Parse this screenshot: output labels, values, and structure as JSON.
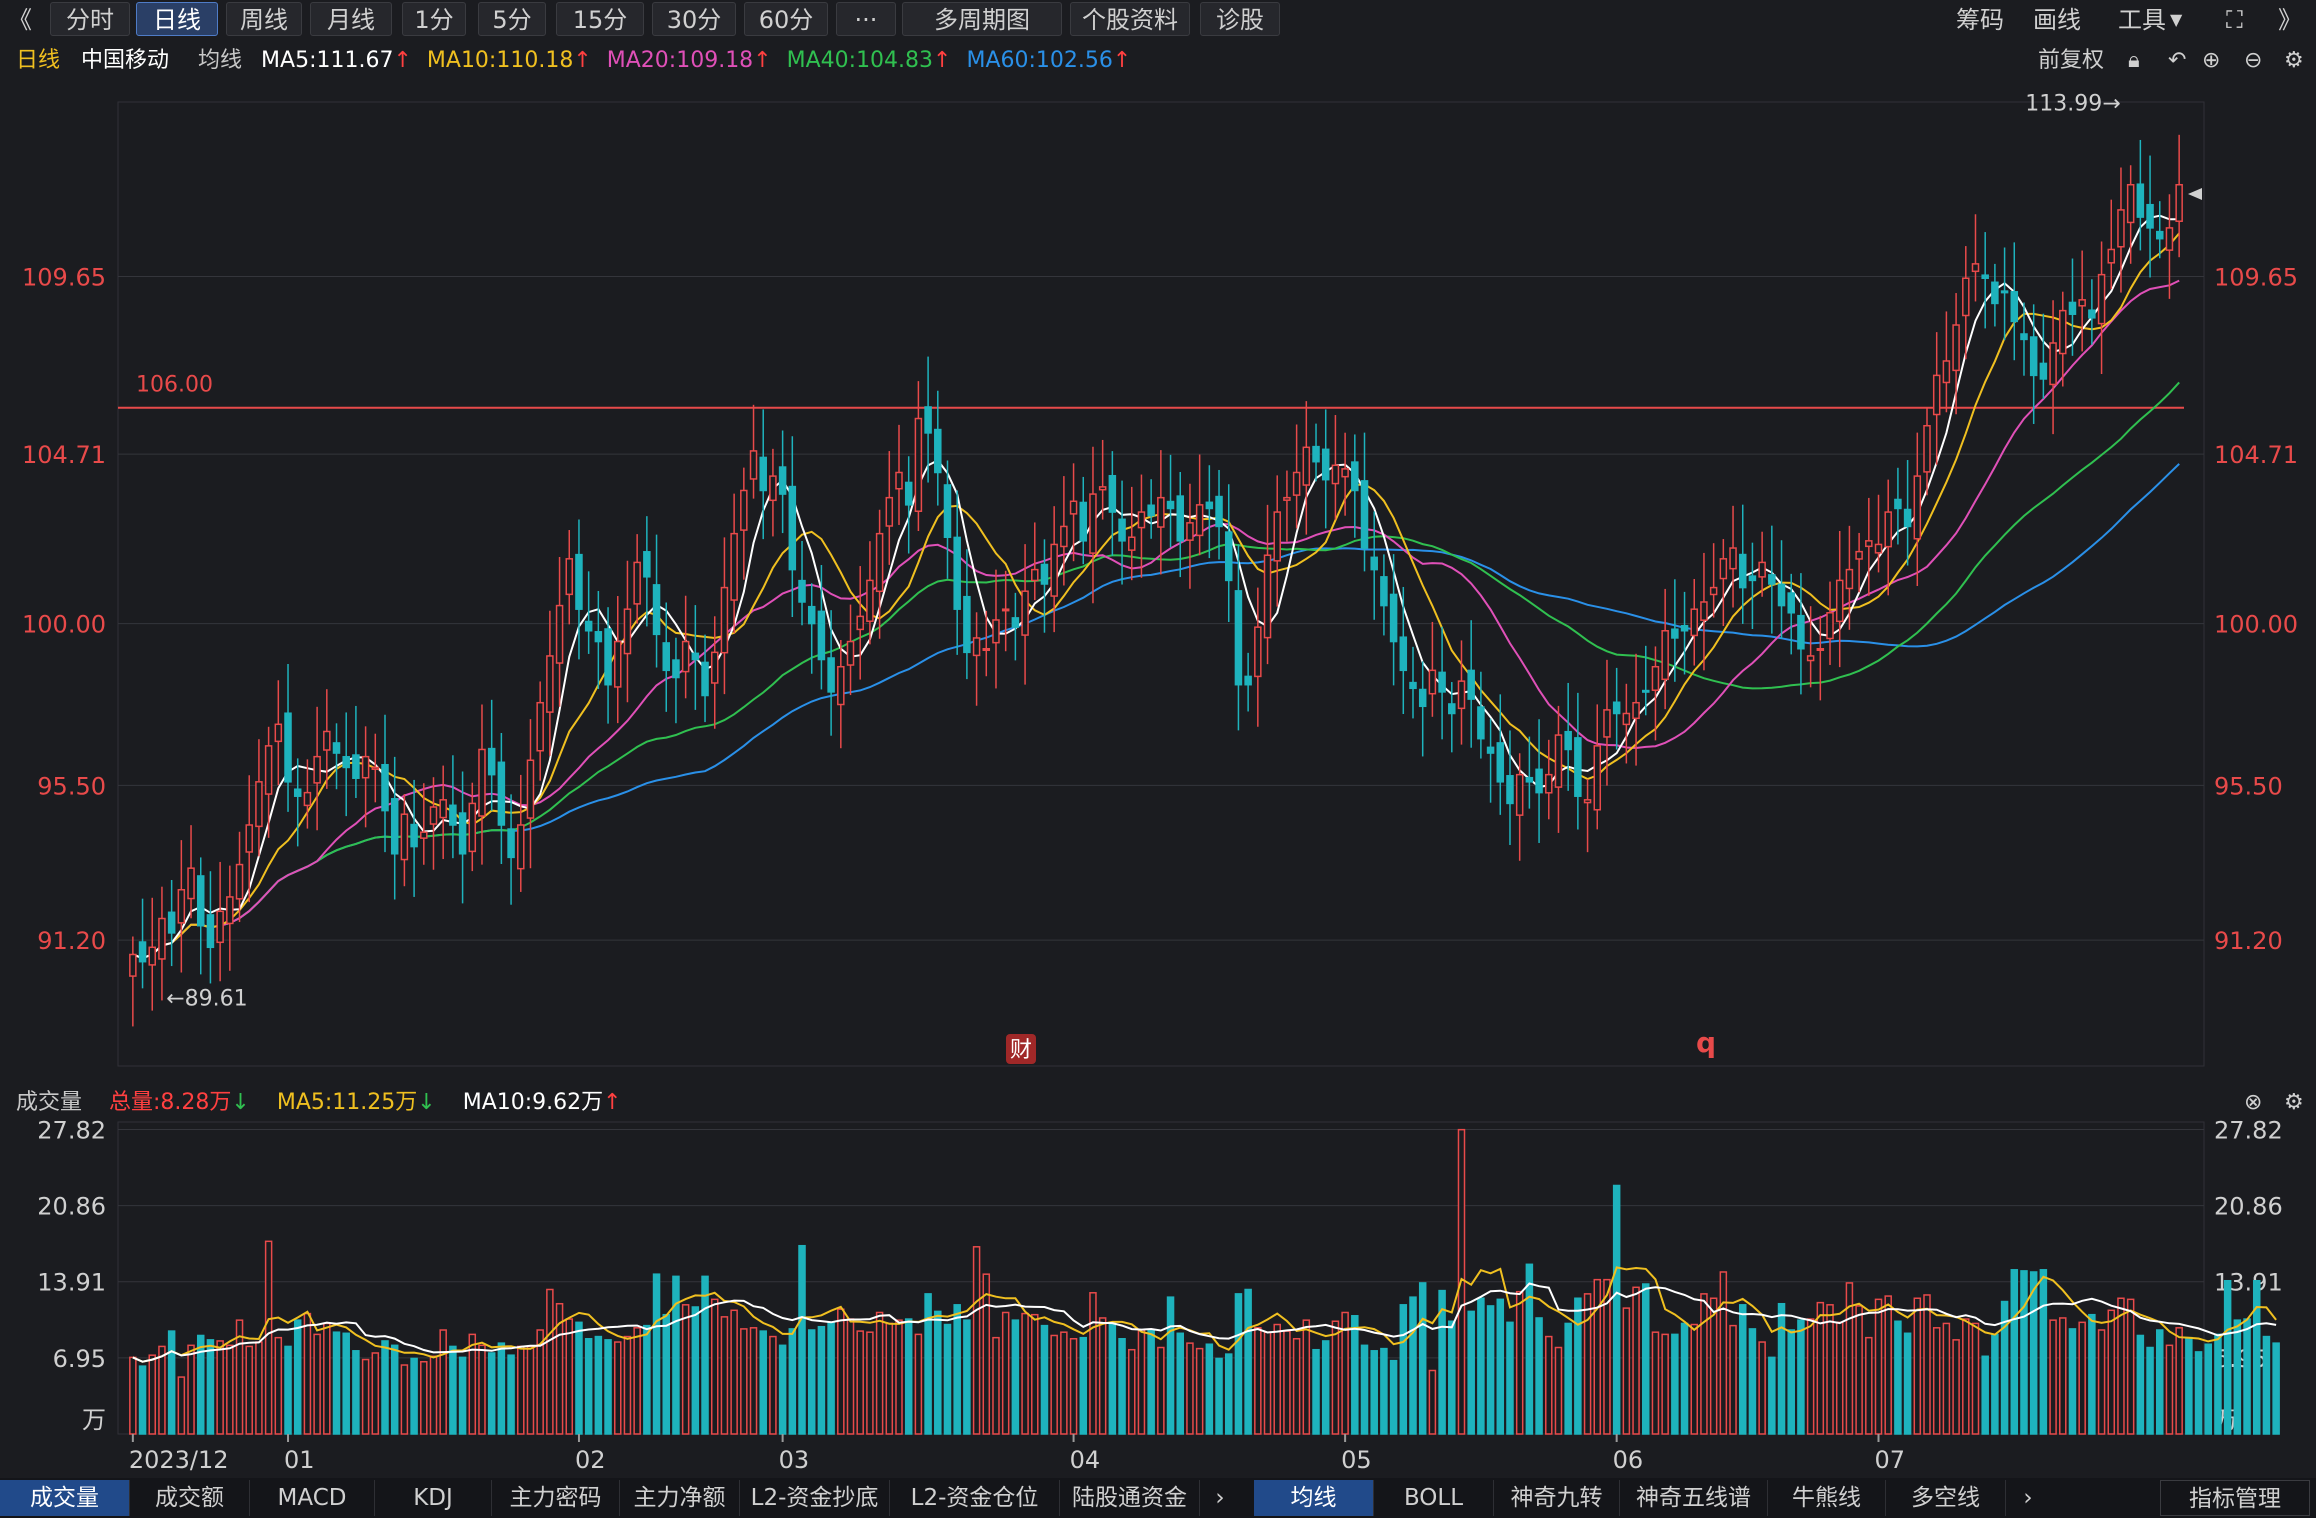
{
  "toolbar": {
    "back": "《",
    "buttons": [
      "分时",
      "日线",
      "周线",
      "月线",
      "1分",
      "5分",
      "15分",
      "30分",
      "60分",
      "···",
      "多周期图",
      "个股资料",
      "诊股"
    ],
    "active": "日线",
    "right": [
      "筹码",
      "画线",
      "工具"
    ]
  },
  "price_legend": {
    "period": "日线",
    "stock": "中国移动",
    "ma_label": "均线",
    "ma5": "MA5:111.67",
    "ma10": "MA10:110.18",
    "ma20": "MA20:109.18",
    "ma40": "MA40:104.83",
    "ma60": "MA60:102.56",
    "adjust": "前复权"
  },
  "volume_legend": {
    "title": "成交量",
    "total": "总量:8.28万",
    "ma5": "MA5:11.25万",
    "ma10": "MA10:9.62万"
  },
  "colors": {
    "up": "#e84a4a",
    "down": "#1eb3bd",
    "ma5": "#ffffff",
    "ma10": "#f0c020",
    "ma20": "#e050b8",
    "ma40": "#30c050",
    "ma60": "#2a90e8",
    "accent": "#2a3f66"
  },
  "chart_data": {
    "type": "candlestick",
    "y_ticks": [
      "109.65",
      "104.71",
      "100.00",
      "95.50",
      "91.20"
    ],
    "ylim": [
      87.7,
      114.5
    ],
    "hline": {
      "value": 106.0,
      "label": "106.00"
    },
    "high_label": "113.99→",
    "low_label": "←89.61",
    "markers": [
      "财",
      "q"
    ],
    "x_labels": [
      "2023/12",
      "01",
      "02",
      "03",
      "04",
      "05",
      "06",
      "07"
    ],
    "volume_ticks": [
      "27.82",
      "20.86",
      "13.91",
      "6.95"
    ],
    "volume_unit": "万",
    "volume_ylim": [
      0,
      28.5
    ],
    "closes": [
      90.8,
      90.6,
      91.0,
      91.8,
      91.4,
      92.6,
      93.2,
      91.6,
      91.0,
      92.0,
      92.4,
      93.3,
      94.4,
      95.6,
      96.6,
      97.2,
      95.6,
      95.2,
      95.3,
      96.3,
      97.0,
      96.4,
      96.0,
      95.7,
      96.3,
      96.0,
      94.8,
      93.6,
      94.7,
      93.8,
      94.2,
      94.9,
      95.1,
      94.4,
      93.6,
      95.0,
      96.5,
      95.8,
      94.4,
      93.5,
      94.4,
      96.2,
      97.8,
      99.1,
      100.5,
      101.8,
      100.4,
      99.8,
      99.5,
      98.3,
      99.5,
      100.4,
      101.7,
      101.3,
      99.7,
      98.7,
      98.5,
      99.5,
      99.0,
      98.0,
      99.2,
      101.0,
      102.5,
      103.7,
      104.8,
      103.7,
      104.1,
      103.6,
      101.5,
      100.6,
      100.0,
      99.0,
      98.1,
      98.8,
      99.5,
      100.2,
      101.2,
      102.5,
      103.5,
      104.2,
      103.3,
      105.7,
      105.3,
      104.2,
      102.4,
      100.4,
      99.2,
      99.6,
      99.3,
      100.1,
      100.4,
      99.9,
      100.9,
      101.5,
      101.1,
      102.2,
      102.7,
      103.4,
      102.3,
      103.6,
      103.8,
      103.1,
      102.3,
      102.4,
      103.1,
      103.0,
      103.5,
      103.2,
      102.3,
      102.8,
      103.3,
      103.2,
      102.7,
      101.2,
      98.3,
      98.3,
      99.9,
      101.9,
      103.1,
      103.5,
      104.2,
      104.9,
      104.5,
      104.0,
      104.4,
      104.3,
      103.7,
      102.1,
      101.5,
      100.5,
      99.5,
      98.7,
      98.2,
      97.7,
      98.7,
      98.1,
      97.5,
      98.4,
      97.9,
      96.8,
      96.4,
      95.6,
      95.0,
      95.8,
      95.6,
      95.3,
      95.8,
      96.9,
      96.5,
      95.2,
      95.1,
      96.6,
      97.6,
      97.5,
      97.5,
      97.8,
      98.1,
      98.8,
      99.8,
      99.6,
      99.8,
      100.4,
      100.6,
      101.0,
      101.8,
      102.1,
      101.0,
      101.2,
      101.7,
      101.1,
      100.5,
      100.3,
      99.3,
      99.1,
      99.3,
      100.3,
      101.2,
      101.5,
      102.0,
      102.3,
      102.2,
      103.1,
      103.2,
      102.7,
      104.1,
      105.5,
      106.9,
      107.3,
      108.3,
      109.6,
      110.0,
      109.6,
      108.9,
      109.2,
      108.4,
      107.9,
      106.9,
      106.8,
      107.8,
      108.7,
      108.6,
      109.0,
      108.5,
      109.7,
      110.4,
      111.5,
      112.2,
      111.3,
      111.0,
      110.7,
      111.0,
      112.2
    ],
    "volumes": [
      7.0,
      6.2,
      7.2,
      8.0,
      9.4,
      5.2,
      8.1,
      9.0,
      8.6,
      8.5,
      8.1,
      10.4,
      8.0,
      8.4,
      17.6,
      8.8,
      8.0,
      10.4,
      11.0,
      9.1,
      10.1,
      9.3,
      9.2,
      7.6,
      6.8,
      7.4,
      8.5,
      8.1,
      6.3,
      6.9,
      6.6,
      7.1,
      9.5,
      8.0,
      7.0,
      9.1,
      8.1,
      7.4,
      8.3,
      7.2,
      8.0,
      8.0,
      9.5,
      13.2,
      11.9,
      10.5,
      10.2,
      8.7,
      8.9,
      8.6,
      8.4,
      8.9,
      9.7,
      9.9,
      14.6,
      10.9,
      14.4,
      11.8,
      11.6,
      14.4,
      12.3,
      10.7,
      11.3,
      9.6,
      9.7,
      9.4,
      8.9,
      8.1,
      9.6,
      17.2,
      9.5,
      9.8,
      10.2,
      11.4,
      10.5,
      9.4,
      9.3,
      11.1,
      10.1,
      10.4,
      10.5,
      9.1,
      12.8,
      11.2,
      10.0,
      11.8,
      10.4,
      17.1,
      14.6,
      8.8,
      11.1,
      10.4,
      11.0,
      10.9,
      9.9,
      9.0,
      9.3,
      8.7,
      8.8,
      12.9,
      10.6,
      10.2,
      8.7,
      7.7,
      9.5,
      9.5,
      7.9,
      12.5,
      9.2,
      8.3,
      7.8,
      8.2,
      6.9,
      7.3,
      12.8,
      13.2,
      9.7,
      9.3,
      10.0,
      9.4,
      8.7,
      10.4,
      7.7,
      8.5,
      10.3,
      11.1,
      10.8,
      8.1,
      7.6,
      7.8,
      6.7,
      11.8,
      12.5,
      13.8,
      5.8,
      13.1,
      10.3,
      27.8,
      11.2,
      12.4,
      11.7,
      12.3,
      10.2,
      13.0,
      15.5,
      10.6,
      8.9,
      7.9,
      10.1,
      12.4,
      12.8,
      14.1,
      14.1,
      22.7,
      11.5,
      13.4,
      13.7,
      9.3,
      9.1,
      9.1,
      10.1,
      10.0,
      12.8,
      12.4,
      14.8,
      9.9,
      11.8,
      9.6,
      8.4,
      7.0,
      11.9,
      9.5,
      10.4,
      10.5,
      12.0,
      11.8,
      10.2,
      13.8,
      11.7,
      8.8,
      12.3,
      12.6,
      10.3,
      9.2,
      12.4,
      12.7,
      9.7,
      10.1,
      8.6,
      10.5,
      10.1,
      7.1,
      9.1,
      12.1,
      15.0,
      14.9,
      14.8,
      15.0,
      10.4,
      10.6,
      9.6,
      10.2,
      10.9,
      9.5,
      11.3,
      12.4,
      12.3,
      9.0,
      7.9,
      9.5,
      8.1,
      9.7,
      8.8,
      7.5,
      8.2,
      9.1,
      14.0,
      10.4,
      10.5,
      14.0,
      8.9,
      8.3
    ]
  },
  "tabs_left": [
    "成交量",
    "成交额",
    "MACD",
    "KDJ",
    "主力密码",
    "主力净额",
    "L2-资金抄底",
    "L2-资金仓位",
    "陆股通资金"
  ],
  "tabs_right": [
    "均线",
    "BOLL",
    "神奇九转",
    "神奇五线谱",
    "牛熊线",
    "多空线"
  ],
  "tab_manage": "指标管理"
}
